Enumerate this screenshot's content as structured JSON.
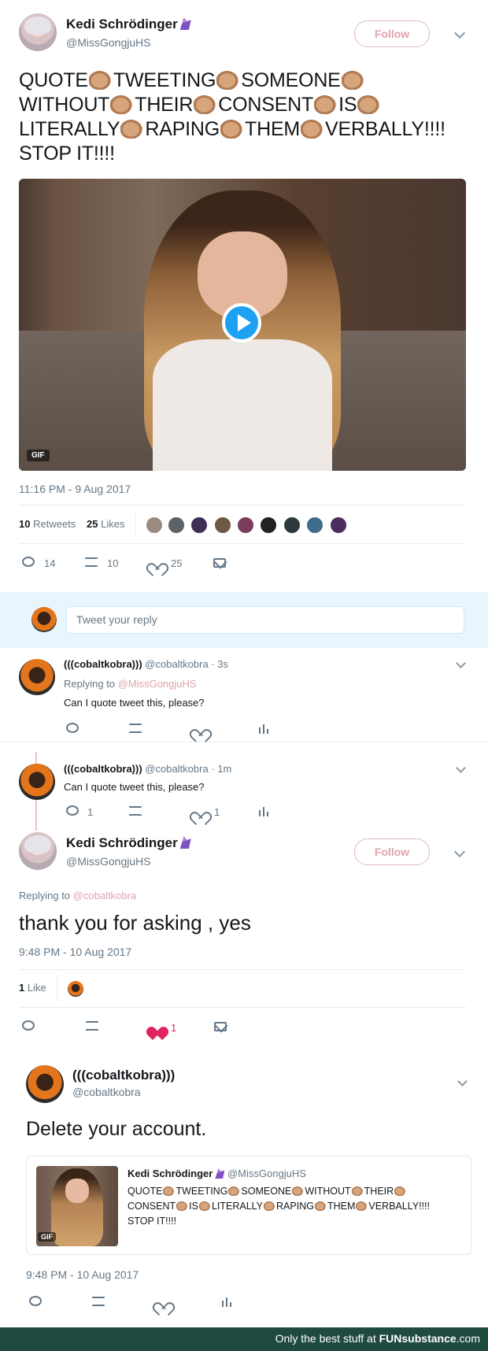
{
  "tweet1": {
    "name": "Kedi Schrödinger",
    "handle": "@MissGongjuHS",
    "follow": "Follow",
    "text_words": [
      "QUOTE",
      "TWEETING",
      "SOMEONE",
      "WITHOUT",
      "THEIR",
      "CONSENT",
      "IS",
      "LITERALLY",
      "RAPING",
      "THEM",
      "VERBALLY!!!!",
      "STOP IT!!!!"
    ],
    "media_badge": "GIF",
    "timestamp": "11:16 PM - 9 Aug 2017",
    "retweets_count": "10",
    "retweets_label": "Retweets",
    "likes_count": "25",
    "likes_label": "Likes",
    "actions": {
      "replies": "14",
      "retweets": "10",
      "likes": "25"
    }
  },
  "reply_box": {
    "placeholder": "Tweet your reply"
  },
  "reply1": {
    "name": "(((cobaltkobra)))",
    "handle": "@cobaltkobra",
    "time": "· 3s",
    "replying_prefix": "Replying to",
    "replying_to": "@MissGongjuHS",
    "text": "Can I quote tweet this, please?"
  },
  "reply2": {
    "name": "(((cobaltkobra)))",
    "handle": "@cobaltkobra",
    "time": "· 1m",
    "text": "Can I quote tweet this, please?",
    "actions": {
      "replies": "1",
      "likes": "1"
    }
  },
  "tweet2": {
    "name": "Kedi Schrödinger",
    "handle": "@MissGongjuHS",
    "follow": "Follow",
    "replying_prefix": "Replying to",
    "replying_to": "@cobaltkobra",
    "text": "thank you for asking , yes",
    "timestamp": "9:48 PM - 10 Aug 2017",
    "likes_count": "1",
    "likes_label": "Like",
    "actions": {
      "likes": "1"
    }
  },
  "tweet3": {
    "name": "(((cobaltkobra)))",
    "handle": "@cobaltkobra",
    "text": "Delete your account.",
    "quote": {
      "name": "Kedi Schrödinger",
      "handle": "@MissGongjuHS",
      "words": [
        "QUOTE",
        "TWEETING",
        "SOMEONE",
        "WITHOUT",
        "THEIR",
        "CONSENT",
        "IS",
        "LITERALLY",
        "RAPING",
        "THEM",
        "VERBALLY!!!!",
        "STOP IT!!!!"
      ],
      "badge": "GIF"
    },
    "timestamp": "9:48 PM - 10 Aug 2017"
  },
  "footer": {
    "prefix": "Only the best stuff at",
    "brand": "FUNsubstance",
    "suffix": ".com"
  },
  "colors": {
    "accent": "#1da1f2",
    "like": "#e0245e",
    "follow": "#e0a3ad",
    "footer_bg": "#1f4a3f"
  },
  "icons": [
    "reply-icon",
    "retweet-icon",
    "heart-icon",
    "mail-icon",
    "stats-icon",
    "chevron-down-icon",
    "play-icon",
    "unicorn-emoji",
    "clap-emoji"
  ]
}
